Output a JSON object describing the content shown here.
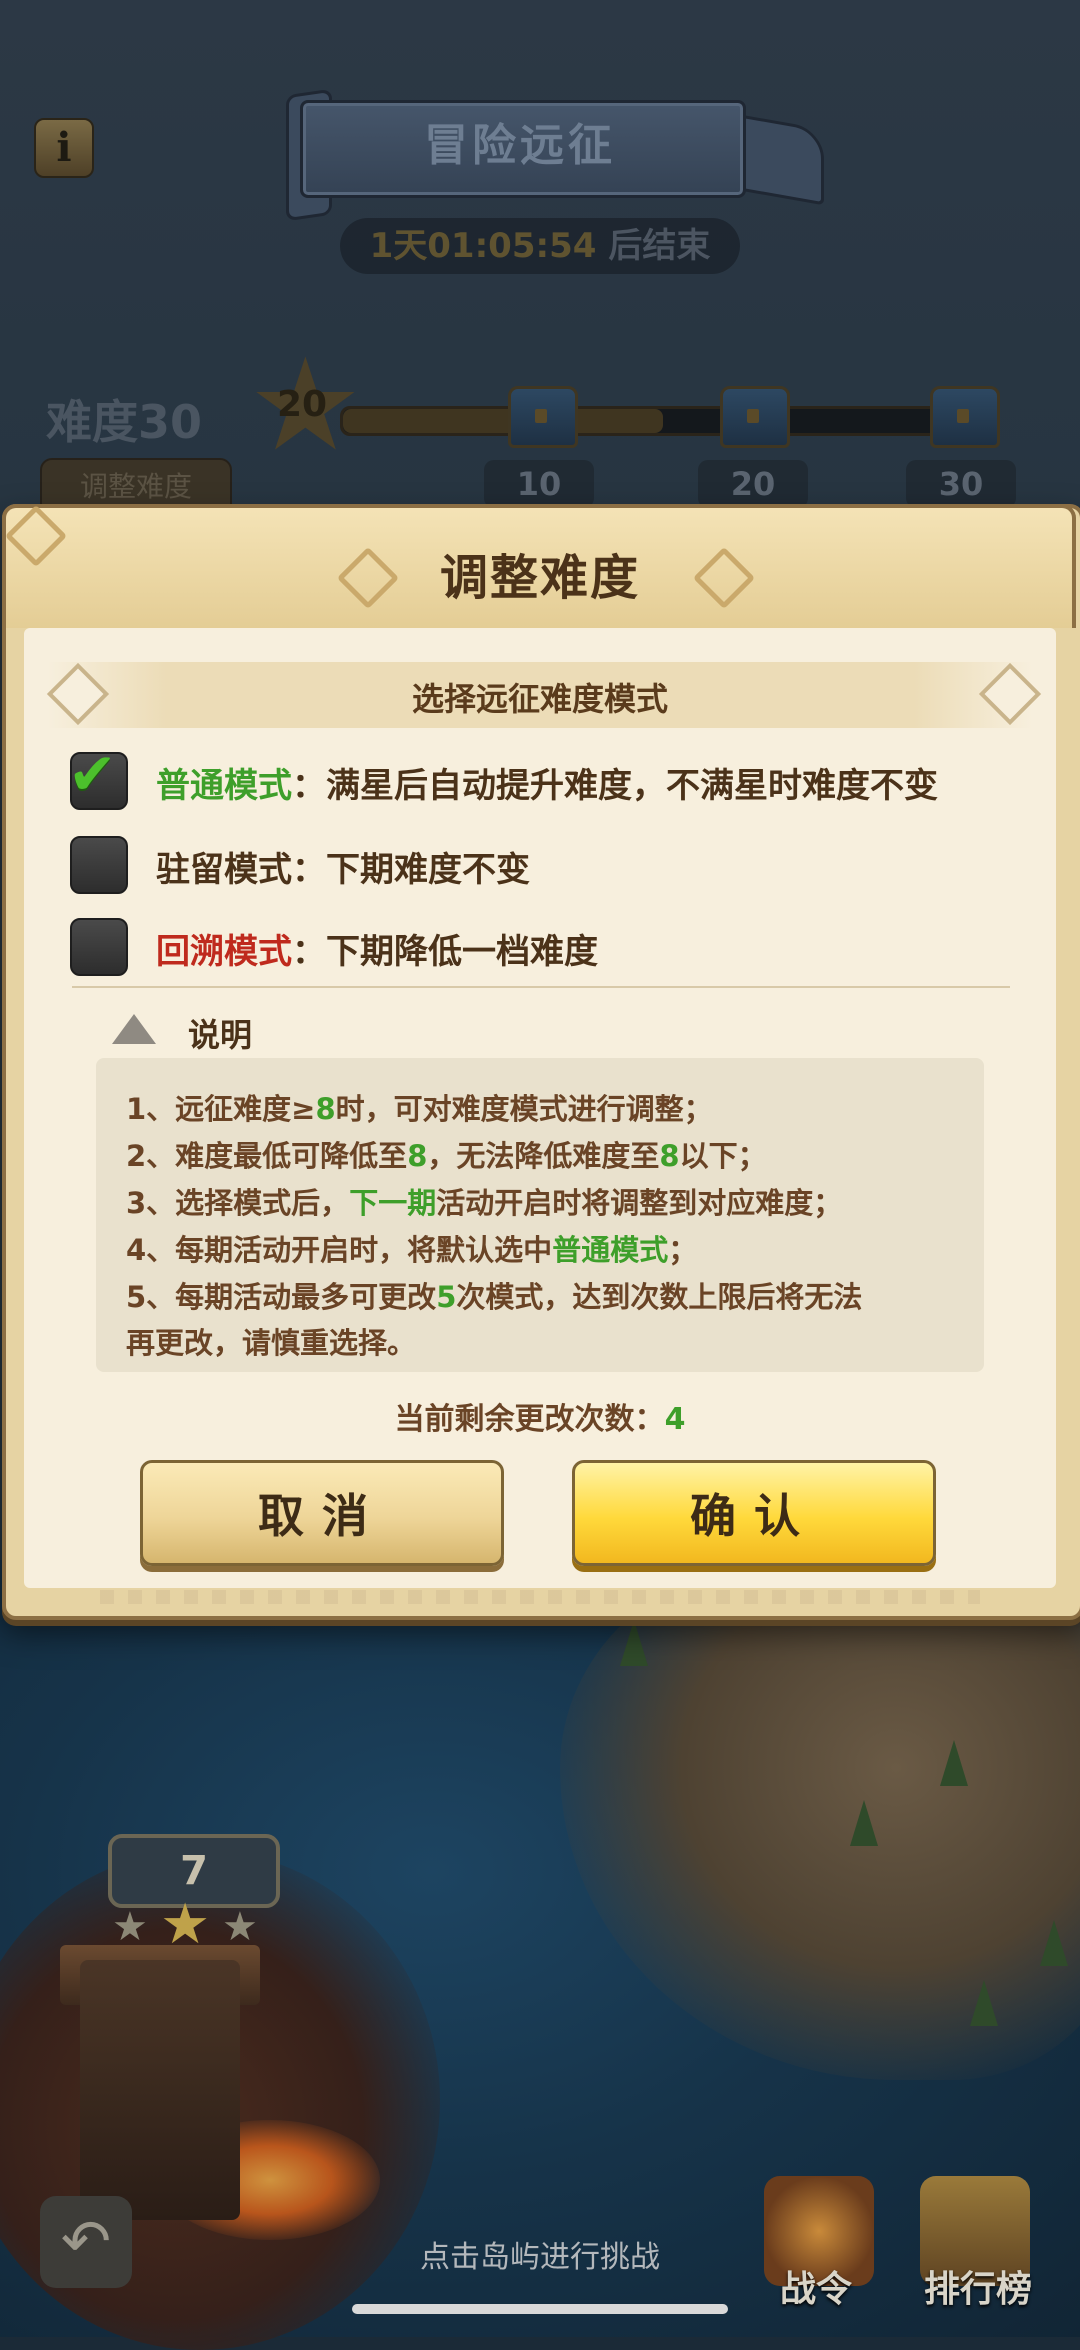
{
  "header": {
    "title": "冒险远征",
    "timer_value": "1天01:05:54",
    "timer_suffix": "后结束"
  },
  "progress": {
    "difficulty_label": "难度30",
    "adjust_button": "调整难度",
    "current_stars": "20",
    "milestones": [
      "10",
      "20",
      "30"
    ],
    "progress_fraction": 0.5
  },
  "modal": {
    "title": "调整难度",
    "section_title": "选择远征难度模式",
    "options": [
      {
        "mode": "普通模式",
        "colon": "：",
        "desc": "满星后自动提升难度，不满星时难度不变",
        "checked": true
      },
      {
        "mode": "驻留模式",
        "colon": "：",
        "desc": "下期难度不变",
        "checked": false
      },
      {
        "mode": "回溯模式",
        "colon": "：",
        "desc": "下期降低一档难度",
        "checked": false
      }
    ],
    "explain_title": "说明",
    "notes": {
      "n1_a": "1、远征难度≥",
      "n1_b": "8",
      "n1_c": "时，可对难度模式进行调整；",
      "n2_a": "2、难度最低可降低至",
      "n2_b": "8",
      "n2_c": "，无法降低难度至",
      "n2_d": "8",
      "n2_e": "以下；",
      "n3_a": "3、选择模式后，",
      "n3_b": "下一期",
      "n3_c": "活动开启时将调整到对应难度；",
      "n4_a": "4、每期活动开启时，将默认选中",
      "n4_b": "普通模式",
      "n4_c": "；",
      "n5_a": "5、每期活动最多可更改",
      "n5_b": "5",
      "n5_c": "次模式，达到次数上限后将无法",
      "n5_d": "再更改，请慎重选择。"
    },
    "remaining_label": "当前剩余更改次数：",
    "remaining_value": "4",
    "cancel_button": "取消",
    "confirm_button": "确认"
  },
  "map": {
    "level_number": "7",
    "hint": "点击岛屿进行挑战",
    "battle_pass_label": "战令",
    "ranking_label": "排行榜"
  },
  "colors": {
    "highlight_green": "#3e9f2a",
    "highlight_red": "#bf2a1d",
    "confirm_yellow": "#ffd93b"
  }
}
